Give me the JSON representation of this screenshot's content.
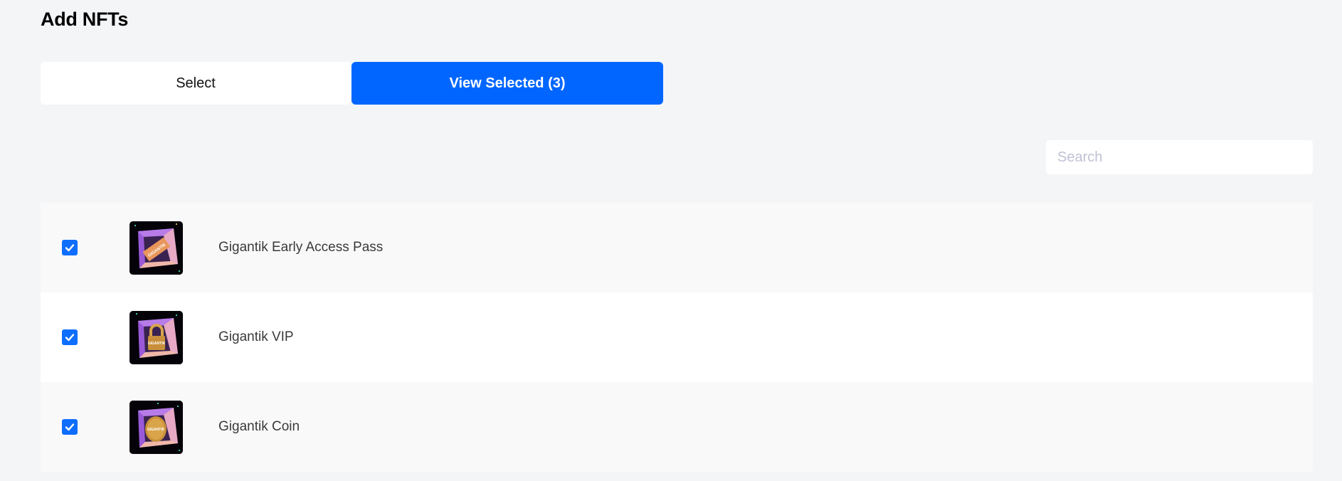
{
  "page": {
    "title": "Add NFTs"
  },
  "tabs": [
    {
      "label": "Select",
      "active": false
    },
    {
      "label": "View Selected (3)",
      "active": true
    }
  ],
  "search": {
    "placeholder": "Search",
    "value": ""
  },
  "colors": {
    "accent": "#0066ff",
    "checkbox": "#0d6efd",
    "background": "#f4f5f7"
  },
  "nfts": [
    {
      "name": "Gigantik Early Access Pass",
      "checked": true,
      "image": "ticket-in-cube",
      "label_on_item": "GIGANTIK"
    },
    {
      "name": "Gigantik VIP",
      "checked": true,
      "image": "padlock-in-cube",
      "label_on_item": "GIGANTIK"
    },
    {
      "name": "Gigantik Coin",
      "checked": true,
      "image": "coin-in-cube",
      "label_on_item": "GIGANTIK"
    }
  ]
}
